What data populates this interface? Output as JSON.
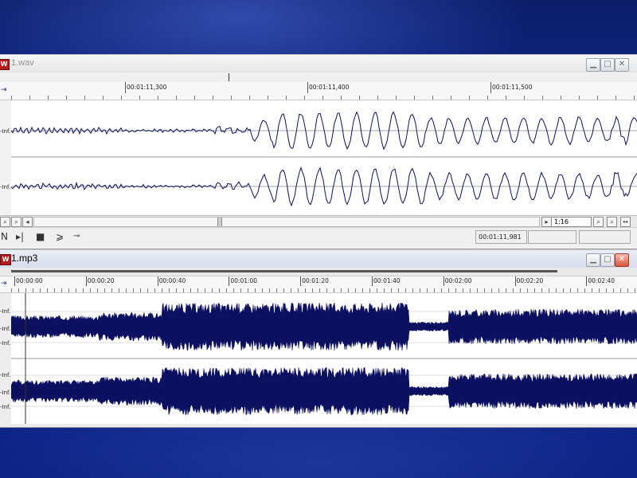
{
  "colors": {
    "waveform": "#0c1060",
    "background": "#0b1d6a"
  },
  "wav_window": {
    "title": "1.wav",
    "icon": "wave-file-icon",
    "window_buttons": [
      "minimize",
      "maximize",
      "close"
    ],
    "ruler": {
      "labels": [
        "00:01:11,300",
        "00:01:11,400",
        "00:01:11,500"
      ]
    },
    "channel_labels": [
      "-Inf.",
      "-Inf."
    ],
    "zoom_field": "1:16",
    "time_readout": "00:01:11,981",
    "empty_fields": [
      "",
      ""
    ]
  },
  "mp3_window": {
    "title": "1.mp3",
    "icon": "wave-file-icon",
    "window_buttons": [
      "minimize",
      "maximize",
      "close"
    ],
    "ruler": {
      "labels": [
        "00:00:00",
        "00:00:20",
        "00:00:40",
        "00:01:00",
        "00:01:20",
        "00:01:40",
        "00:02:00",
        "00:02:20",
        "00:02:40"
      ]
    },
    "channel1_labels": [
      "-Inf.",
      "-Inf.",
      "-Inf."
    ],
    "channel2_labels": [
      "-Inf.",
      "-Inf.",
      "-Inf."
    ]
  }
}
